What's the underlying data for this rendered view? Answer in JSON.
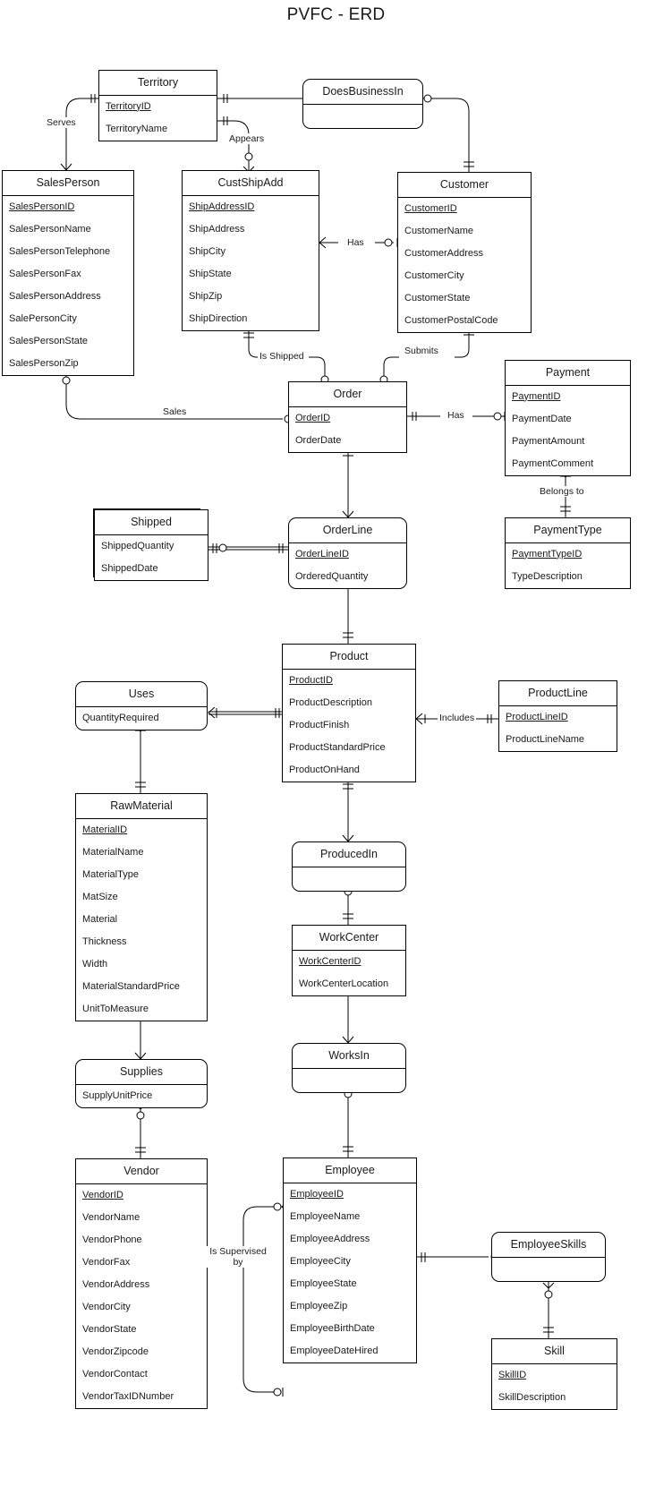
{
  "title": "PVFC - ERD",
  "diagram_type": "entity-relationship-diagram",
  "entities": [
    {
      "id": "territory",
      "name": "Territory",
      "shape": "rectangle",
      "attributes": [
        {
          "label": "TerritoryID",
          "key": true
        },
        {
          "label": "TerritoryName",
          "key": false
        }
      ]
    },
    {
      "id": "does_business_in",
      "name": "DoesBusinessIn",
      "shape": "rounded",
      "attributes": []
    },
    {
      "id": "salesperson",
      "name": "SalesPerson",
      "shape": "rectangle",
      "attributes": [
        {
          "label": "SalesPersonID",
          "key": true
        },
        {
          "label": "SalesPersonName",
          "key": false
        },
        {
          "label": "SalesPersonTelephone",
          "key": false
        },
        {
          "label": "SalesPersonFax",
          "key": false
        },
        {
          "label": "SalesPersonAddress",
          "key": false
        },
        {
          "label": "SalePersonCity",
          "key": false
        },
        {
          "label": "SalesPersonState",
          "key": false
        },
        {
          "label": "SalesPersonZip",
          "key": false
        }
      ]
    },
    {
      "id": "custshipadd",
      "name": "CustShipAdd",
      "shape": "rectangle",
      "attributes": [
        {
          "label": "ShipAddressID",
          "key": true
        },
        {
          "label": "ShipAddress",
          "key": false
        },
        {
          "label": "ShipCity",
          "key": false
        },
        {
          "label": "ShipState",
          "key": false
        },
        {
          "label": "ShipZip",
          "key": false
        },
        {
          "label": "ShipDirection",
          "key": false
        }
      ]
    },
    {
      "id": "customer",
      "name": "Customer",
      "shape": "rectangle",
      "attributes": [
        {
          "label": "CustomerID",
          "key": true
        },
        {
          "label": "CustomerName",
          "key": false
        },
        {
          "label": "CustomerAddress",
          "key": false
        },
        {
          "label": "CustomerCity",
          "key": false
        },
        {
          "label": "CustomerState",
          "key": false
        },
        {
          "label": "CustomerPostalCode",
          "key": false
        }
      ]
    },
    {
      "id": "order",
      "name": "Order",
      "shape": "rectangle",
      "attributes": [
        {
          "label": "OrderID",
          "key": true
        },
        {
          "label": "OrderDate",
          "key": false
        }
      ]
    },
    {
      "id": "payment",
      "name": "Payment",
      "shape": "rectangle",
      "attributes": [
        {
          "label": "PaymentID",
          "key": true
        },
        {
          "label": "PaymentDate",
          "key": false
        },
        {
          "label": "PaymentAmount",
          "key": false
        },
        {
          "label": "PaymentComment",
          "key": false
        }
      ]
    },
    {
      "id": "paymenttype",
      "name": "PaymentType",
      "shape": "rectangle",
      "attributes": [
        {
          "label": "PaymentTypeID",
          "key": true
        },
        {
          "label": "TypeDescription",
          "key": false
        }
      ]
    },
    {
      "id": "shipped",
      "name": "Shipped",
      "shape": "weak",
      "attributes": [
        {
          "label": "ShippedQuantity",
          "key": false
        },
        {
          "label": "ShippedDate",
          "key": false
        }
      ]
    },
    {
      "id": "orderline",
      "name": "OrderLine",
      "shape": "rounded",
      "attributes": [
        {
          "label": "OrderLineID",
          "key": true
        },
        {
          "label": "OrderedQuantity",
          "key": false
        }
      ]
    },
    {
      "id": "product",
      "name": "Product",
      "shape": "rectangle",
      "attributes": [
        {
          "label": "ProductID",
          "key": true
        },
        {
          "label": "ProductDescription",
          "key": false
        },
        {
          "label": "ProductFinish",
          "key": false
        },
        {
          "label": "ProductStandardPrice",
          "key": false
        },
        {
          "label": "ProductOnHand",
          "key": false
        }
      ]
    },
    {
      "id": "productline",
      "name": "ProductLine",
      "shape": "rectangle",
      "attributes": [
        {
          "label": "ProductLineID",
          "key": true
        },
        {
          "label": "ProductLineName",
          "key": false
        }
      ]
    },
    {
      "id": "uses",
      "name": "Uses",
      "shape": "rounded",
      "attributes": [
        {
          "label": "QuantityRequired",
          "key": false
        }
      ]
    },
    {
      "id": "rawmaterial",
      "name": "RawMaterial",
      "shape": "rectangle",
      "attributes": [
        {
          "label": "MaterialID",
          "key": true
        },
        {
          "label": "MaterialName",
          "key": false
        },
        {
          "label": "MaterialType",
          "key": false
        },
        {
          "label": "MatSize",
          "key": false
        },
        {
          "label": "Material",
          "key": false
        },
        {
          "label": "Thickness",
          "key": false
        },
        {
          "label": "Width",
          "key": false
        },
        {
          "label": "MaterialStandardPrice",
          "key": false
        },
        {
          "label": "UnitToMeasure",
          "key": false
        }
      ]
    },
    {
      "id": "producedin",
      "name": "ProducedIn",
      "shape": "rounded",
      "attributes": []
    },
    {
      "id": "workcenter",
      "name": "WorkCenter",
      "shape": "rectangle",
      "attributes": [
        {
          "label": "WorkCenterID",
          "key": true
        },
        {
          "label": "WorkCenterLocation",
          "key": false
        }
      ]
    },
    {
      "id": "worksin",
      "name": "WorksIn",
      "shape": "rounded",
      "attributes": []
    },
    {
      "id": "supplies",
      "name": "Supplies",
      "shape": "rounded",
      "attributes": [
        {
          "label": "SupplyUnitPrice",
          "key": false
        }
      ]
    },
    {
      "id": "vendor",
      "name": "Vendor",
      "shape": "rectangle",
      "attributes": [
        {
          "label": "VendorID",
          "key": true
        },
        {
          "label": "VendorName",
          "key": false
        },
        {
          "label": "VendorPhone",
          "key": false
        },
        {
          "label": "VendorFax",
          "key": false
        },
        {
          "label": "VendorAddress",
          "key": false
        },
        {
          "label": "VendorCity",
          "key": false
        },
        {
          "label": "VendorState",
          "key": false
        },
        {
          "label": "VendorZipcode",
          "key": false
        },
        {
          "label": "VendorContact",
          "key": false
        },
        {
          "label": "VendorTaxIDNumber",
          "key": false
        }
      ]
    },
    {
      "id": "employee",
      "name": "Employee",
      "shape": "rectangle",
      "attributes": [
        {
          "label": "EmployeeID",
          "key": true
        },
        {
          "label": "EmployeeName",
          "key": false
        },
        {
          "label": "EmployeeAddress",
          "key": false
        },
        {
          "label": "EmployeeCity",
          "key": false
        },
        {
          "label": "EmployeeState",
          "key": false
        },
        {
          "label": "EmployeeZip",
          "key": false
        },
        {
          "label": "EmployeeBirthDate",
          "key": false
        },
        {
          "label": "EmployeeDateHired",
          "key": false
        }
      ]
    },
    {
      "id": "employeeskills",
      "name": "EmployeeSkills",
      "shape": "rounded",
      "attributes": []
    },
    {
      "id": "skill",
      "name": "Skill",
      "shape": "rectangle",
      "attributes": [
        {
          "label": "SkillID",
          "key": true
        },
        {
          "label": "SkillDescription",
          "key": false
        }
      ]
    }
  ],
  "relationship_labels": [
    {
      "id": "serves",
      "label": "Serves"
    },
    {
      "id": "appears",
      "label": "Appears"
    },
    {
      "id": "has_cust",
      "label": "Has"
    },
    {
      "id": "is_shipped",
      "label": "Is Shipped"
    },
    {
      "id": "submits",
      "label": "Submits"
    },
    {
      "id": "sales",
      "label": "Sales"
    },
    {
      "id": "has_payment",
      "label": "Has"
    },
    {
      "id": "belongs_to",
      "label": "Belongs to"
    },
    {
      "id": "includes",
      "label": "Includes"
    },
    {
      "id": "is_supervised_by",
      "label": "Is Supervised by"
    }
  ]
}
